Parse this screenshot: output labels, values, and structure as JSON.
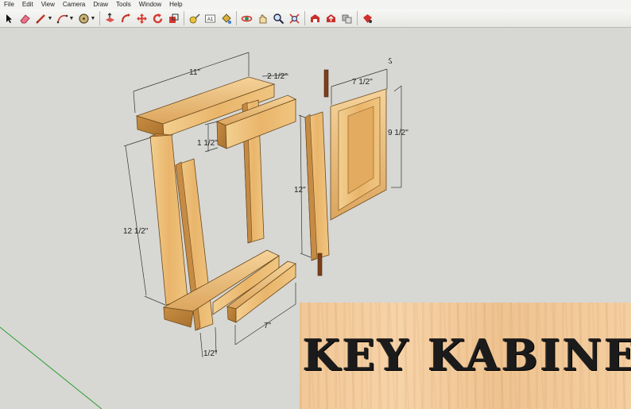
{
  "menu": {
    "items": [
      "File",
      "Edit",
      "View",
      "Camera",
      "Draw",
      "Tools",
      "Window",
      "Help"
    ]
  },
  "toolbar": {
    "tools": [
      {
        "name": "select-icon"
      },
      {
        "name": "eraser-icon"
      },
      {
        "name": "pencil-line-icon",
        "dropdown": true
      },
      {
        "name": "arc-icon",
        "dropdown": true
      },
      {
        "name": "circle-shape-icon",
        "dropdown": true
      },
      {
        "name": "push-pull-icon"
      },
      {
        "name": "follow-me-icon"
      },
      {
        "name": "move-icon"
      },
      {
        "name": "rotate-icon"
      },
      {
        "name": "scale-icon"
      },
      {
        "name": "tape-measure-icon"
      },
      {
        "name": "text-label-icon",
        "text": "A1"
      },
      {
        "name": "paint-bucket-icon"
      },
      {
        "name": "orbit-icon"
      },
      {
        "name": "pan-icon"
      },
      {
        "name": "zoom-icon"
      },
      {
        "name": "zoom-extents-icon"
      },
      {
        "name": "warehouse-icon"
      },
      {
        "name": "share-model-icon"
      },
      {
        "name": "components-icon"
      },
      {
        "name": "extension-warehouse-icon"
      }
    ]
  },
  "dimensions": {
    "top_width": "11\"",
    "top_depth": "2 1/2\"",
    "rail_height": "1 1/2\"",
    "side_height": "12 1/2\"",
    "bottom_width": "1/2\"",
    "shelf_width": "7\"",
    "hinge_stile_height": "12\"",
    "door_width": "7 1/2\"",
    "door_height": "9 1/2\""
  },
  "banner": {
    "title": "KEY KABINET"
  },
  "colors": {
    "wood_light": "#f2c784",
    "wood_mid": "#e2ad62",
    "wood_dark": "#b57d35",
    "axis_green": "#2aa02a"
  }
}
